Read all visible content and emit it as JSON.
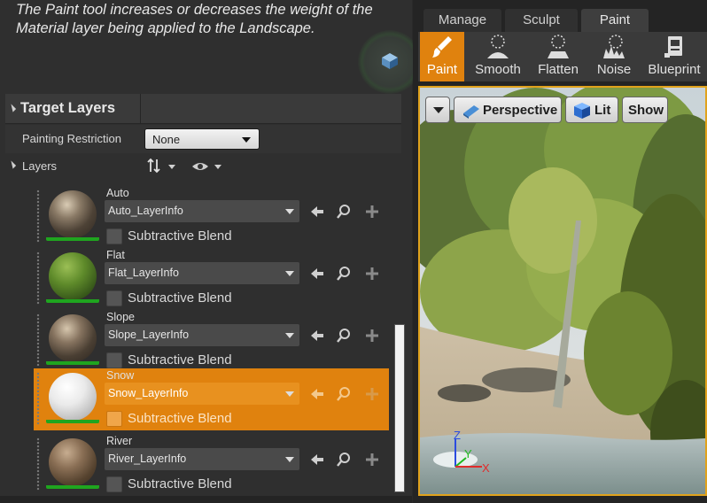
{
  "description": "The Paint tool increases or decreases the weight of the Material layer being applied to the Landscape.",
  "target_layers": {
    "title": "Target Layers",
    "painting_restriction_label": "Painting Restriction",
    "painting_restriction_value": "None",
    "layers_label": "Layers"
  },
  "layers": [
    {
      "name": "Auto",
      "info": "Auto_LayerInfo",
      "subtractive_label": "Subtractive Blend"
    },
    {
      "name": "Flat",
      "info": "Flat_LayerInfo",
      "subtractive_label": "Subtractive Blend"
    },
    {
      "name": "Slope",
      "info": "Slope_LayerInfo",
      "subtractive_label": "Subtractive Blend"
    },
    {
      "name": "Snow",
      "info": "Snow_LayerInfo",
      "subtractive_label": "Subtractive Blend"
    },
    {
      "name": "River",
      "info": "River_LayerInfo",
      "subtractive_label": "Subtractive Blend"
    }
  ],
  "selected_layer": "Snow",
  "tabs": [
    "Manage",
    "Sculpt",
    "Paint"
  ],
  "active_tab": "Paint",
  "tools": [
    "Paint",
    "Smooth",
    "Flatten",
    "Noise",
    "Blueprint"
  ],
  "active_tool": "Paint",
  "viewport": {
    "perspective_label": "Perspective",
    "lit_label": "Lit",
    "show_label": "Show"
  },
  "gizmo": {
    "z": "Z",
    "y": "Y",
    "x": "X"
  },
  "colors": {
    "accent": "#e0820e",
    "layer_bar": "#1fa51f",
    "viewport_border": "#e0a21c"
  }
}
